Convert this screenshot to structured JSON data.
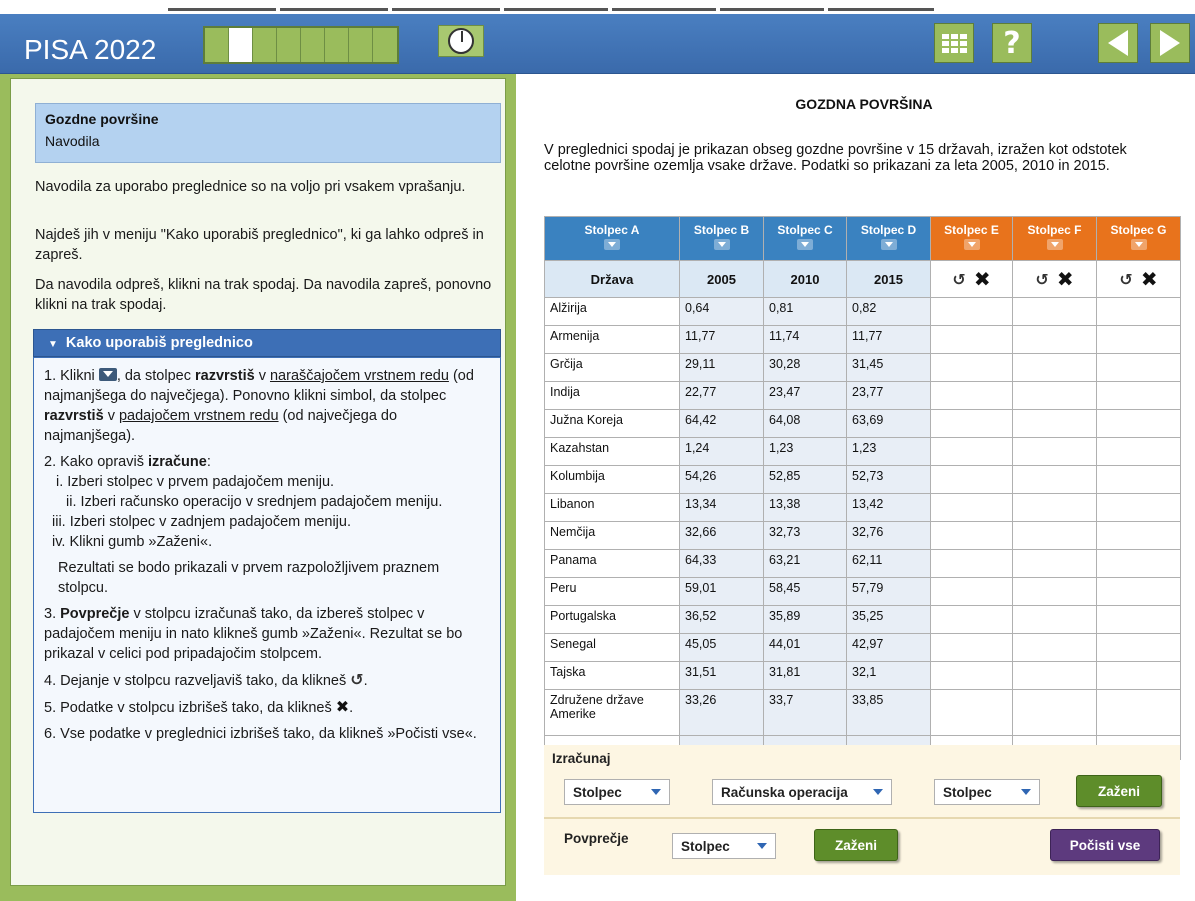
{
  "header": {
    "title": "PISA 2022",
    "progress": {
      "total_cells": 8,
      "active_index": 1
    },
    "icons": [
      "timer-icon",
      "calculator-icon",
      "help-icon",
      "prev-arrow-icon",
      "next-arrow-icon"
    ],
    "help_glyph": "?",
    "colors": {
      "header_bg": "#3f74b8",
      "accent_green": "#9abc5c"
    }
  },
  "left": {
    "box_title": "Gozdne površine",
    "box_subtitle": "Navodila",
    "p1": "Navodila za uporabo preglednice so na voljo pri vsakem vprašanju.",
    "p2": "Najdeš jih v meniju \"Kako uporabiš preglednico\", ki ga lahko odpreš in zapreš.",
    "p3": "Da navodila odpreš, klikni na trak spodaj. Da navodila zapreš, ponovno klikni na trak spodaj.",
    "howto_title": "Kako uporabiš preglednico",
    "howto": {
      "i1_a": "1. Klikni",
      "i1_b": ", da stolpec",
      "i1_bold1": "razvrstiš",
      "i1_c": "v",
      "i1_u1": "naraščajočem vrstnem redu",
      "i1_d": "(od najmanjšega do največjega). Ponovno klikni simbol, da stolpec",
      "i1_bold2": "razvrstiš",
      "i1_e": "v",
      "i1_u2": "padajočem vrstnem redu",
      "i1_f": "(od največjega do najmanjšega).",
      "i2_a": "2. Kako opraviš",
      "i2_bold": "izračune",
      "i2_colon": ":",
      "i2_i": "i. Izberi stolpec v prvem padajočem meniju.",
      "i2_ii": "ii. Izberi računsko operacijo v srednjem padajočem meniju.",
      "i2_iii": "iii. Izberi stolpec v zadnjem padajočem meniju.",
      "i2_iv": "iv. Klikni gumb »Zaženi«.",
      "i2_note": "Rezultati se bodo prikazali v prvem razpoložljivem praznem stolpcu.",
      "i3_a": "3.",
      "i3_bold": "Povprečje",
      "i3_b": "v stolpcu izračunaš tako, da izbereš stolpec v padajočem meniju in nato klikneš gumb »Zaženi«. Rezultat se bo prikazal v celici pod pripadajočim stolpcem.",
      "i4": "4. Dejanje v stolpcu razveljaviš tako, da klikneš",
      "i5": "5. Podatke v stolpcu izbrišeš tako, da klikneš",
      "i6": "6. Vse podatke v preglednici izbrišeš tako, da klikneš »Počisti vse«.",
      "undo_glyph": "↺",
      "x_glyph": "✖",
      "period": "."
    }
  },
  "right": {
    "title": "GOZDNA POVRŠINA",
    "intro": "V preglednici spodaj je prikazan obseg gozdne površine v 15 državah, izražen kot odstotek celotne površine ozemlja vsake države. Podatki so prikazani za leta 2005, 2010 in 2015.",
    "columns": [
      "Stolpec A",
      "Stolpec B",
      "Stolpec C",
      "Stolpec D",
      "Stolpec E",
      "Stolpec F",
      "Stolpec G"
    ],
    "subheaders": [
      "Država",
      "2005",
      "2010",
      "2015"
    ],
    "rows": [
      [
        "Alžirija",
        "0,64",
        "0,81",
        "0,82"
      ],
      [
        "Armenija",
        "11,77",
        "11,74",
        "11,77"
      ],
      [
        "Grčija",
        "29,11",
        "30,28",
        "31,45"
      ],
      [
        "Indija",
        "22,77",
        "23,47",
        "23,77"
      ],
      [
        "Južna Koreja",
        "64,42",
        "64,08",
        "63,69"
      ],
      [
        "Kazahstan",
        "1,24",
        "1,23",
        "1,23"
      ],
      [
        "Kolumbija",
        "54,26",
        "52,85",
        "52,73"
      ],
      [
        "Libanon",
        "13,34",
        "13,38",
        "13,42"
      ],
      [
        "Nemčija",
        "32,66",
        "32,73",
        "32,76"
      ],
      [
        "Panama",
        "64,33",
        "63,21",
        "62,11"
      ],
      [
        "Peru",
        "59,01",
        "58,45",
        "57,79"
      ],
      [
        "Portugalska",
        "36,52",
        "35,89",
        "35,25"
      ],
      [
        "Senegal",
        "45,05",
        "44,01",
        "42,97"
      ],
      [
        "Tajska",
        "31,51",
        "31,81",
        "32,1"
      ],
      [
        "Združene države Amerike",
        "33,26",
        "33,7",
        "33,85"
      ]
    ],
    "calc": {
      "label": "Izračunaj",
      "col1": "Stolpec",
      "operation": "Računska operacija",
      "col2": "Stolpec",
      "run": "Zaženi"
    },
    "avg": {
      "label": "Povprečje",
      "col": "Stolpec",
      "run": "Zaženi",
      "clear": "Počisti vse"
    }
  }
}
